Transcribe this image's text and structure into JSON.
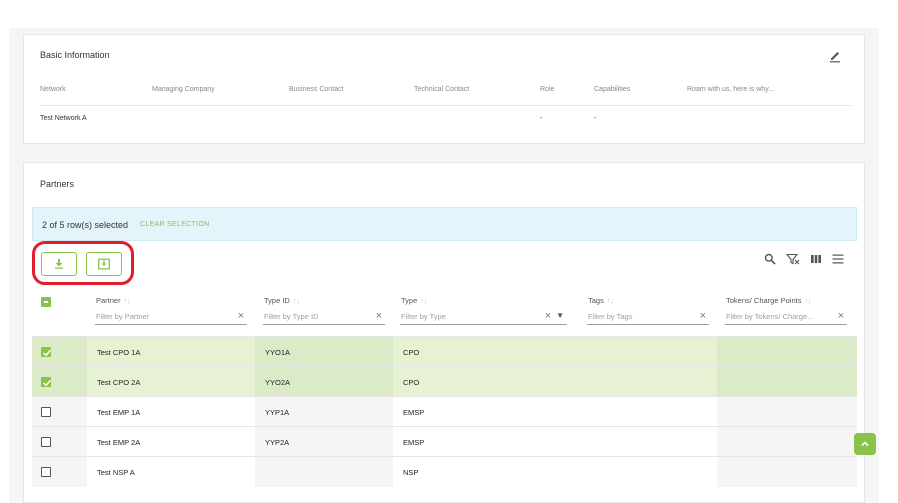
{
  "basic_info": {
    "title": "Basic Information",
    "columns": [
      "Network",
      "Managing Company",
      "Business Contact",
      "Technical Contact",
      "Role",
      "Capabilities",
      "Roam with us, here is why..."
    ],
    "row": [
      "Test Network A",
      "",
      "",
      "",
      "-",
      "-",
      ""
    ]
  },
  "partners": {
    "title": "Partners",
    "selection_text": "2 of 5 row(s) selected",
    "clear_selection": "CLEAR SELECTION",
    "columns": [
      {
        "title": "Partner",
        "filter": "Filter by Partner"
      },
      {
        "title": "Type ID",
        "filter": "Filter by Type ID"
      },
      {
        "title": "Type",
        "filter": "Filter by Type"
      },
      {
        "title": "Tags",
        "filter": "Filter by Tags"
      },
      {
        "title": "Tokens/ Charge Points",
        "filter": "Filter by Tokens/ Charge..."
      }
    ],
    "rows": [
      {
        "selected": true,
        "partner": "Test CPO 1A",
        "type_id": "YYO1A",
        "type": "CPO",
        "tags": "",
        "tokens": ""
      },
      {
        "selected": true,
        "partner": "Test CPO 2A",
        "type_id": "YYO2A",
        "type": "CPO",
        "tags": "",
        "tokens": ""
      },
      {
        "selected": false,
        "partner": "Test EMP 1A",
        "type_id": "YYP1A",
        "type": "EMSP",
        "tags": "",
        "tokens": ""
      },
      {
        "selected": false,
        "partner": "Test EMP 2A",
        "type_id": "YYP2A",
        "type": "EMSP",
        "tags": "",
        "tokens": ""
      },
      {
        "selected": false,
        "partner": "Test NSP A",
        "type_id": "",
        "type": "NSP",
        "tags": "",
        "tokens": ""
      }
    ]
  },
  "icons": {
    "edit": "pencil-icon",
    "download": "download-icon",
    "export": "export-icon",
    "search": "search-icon",
    "clear_filters": "clear-filter-icon",
    "columns": "view-column-icon",
    "menu": "menu-icon",
    "scroll_top": "chevron-up-icon"
  },
  "colors": {
    "accent": "#8bc34a",
    "selection_bg": "#e4f4fb",
    "selected_row": "#e6f2d3",
    "highlight": "#e11d2a"
  }
}
